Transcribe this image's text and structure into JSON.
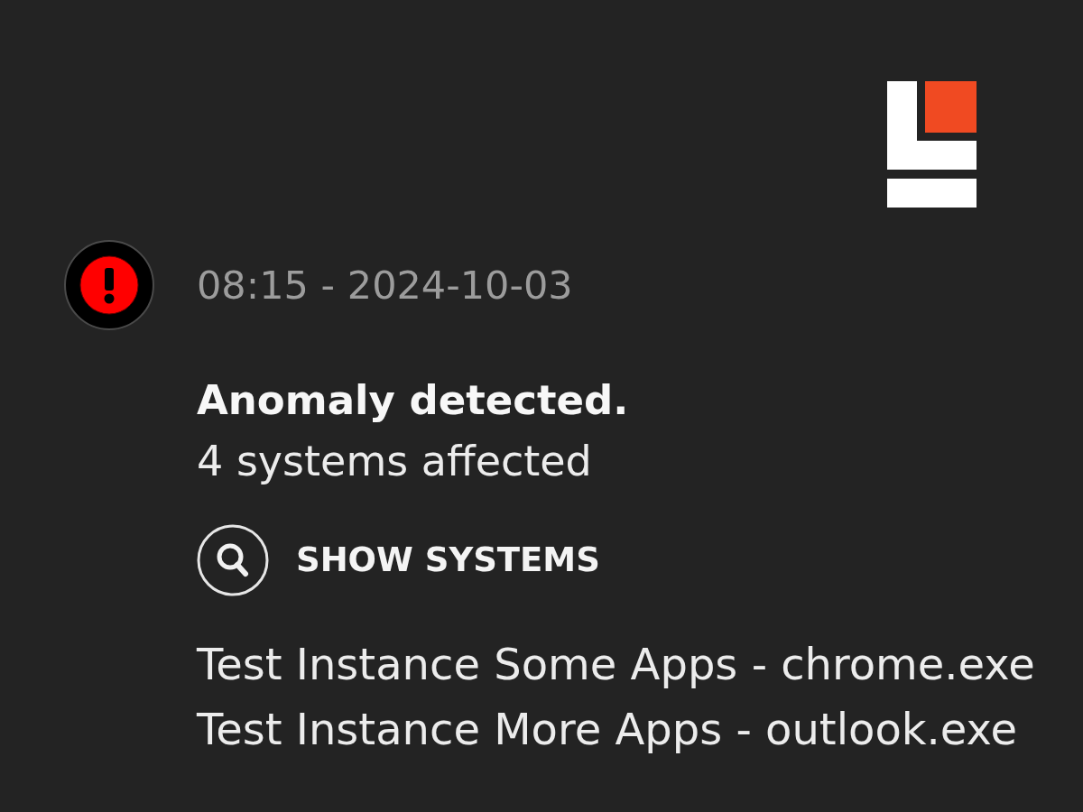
{
  "alert": {
    "timestamp": "08:15 - 2024-10-03",
    "title": "Anomaly detected.",
    "summary": "4 systems affected",
    "action": {
      "label": "SHOW SYSTEMS"
    },
    "systems": [
      "Test Instance Some Apps - chrome.exe",
      "Test Instance More Apps - outlook.exe"
    ]
  }
}
